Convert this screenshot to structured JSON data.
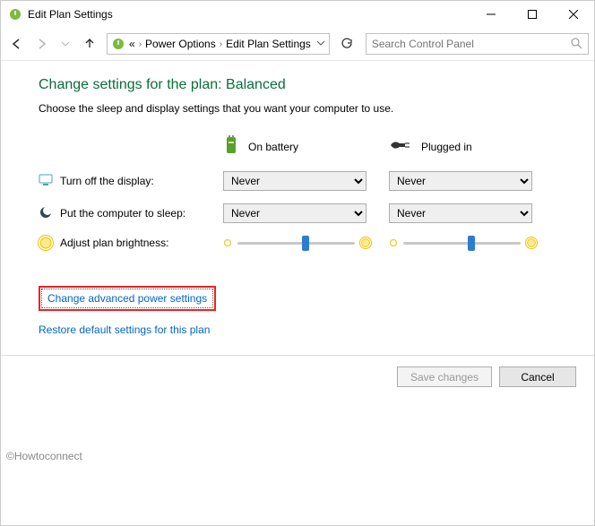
{
  "window": {
    "title": "Edit Plan Settings",
    "breadcrumb": {
      "overflow": "«",
      "item1": "Power Options",
      "item2": "Edit Plan Settings"
    },
    "search_placeholder": "Search Control Panel"
  },
  "main": {
    "heading": "Change settings for the plan: Balanced",
    "subhead": "Choose the sleep and display settings that you want your computer to use.",
    "columns": {
      "battery": "On battery",
      "plugged": "Plugged in"
    },
    "rows": {
      "display_off": {
        "label": "Turn off the display:",
        "battery_value": "Never",
        "plugged_value": "Never"
      },
      "sleep": {
        "label": "Put the computer to sleep:",
        "battery_value": "Never",
        "plugged_value": "Never"
      },
      "brightness": {
        "label": "Adjust plan brightness:",
        "battery_pos_pct": 55,
        "plugged_pos_pct": 55
      }
    },
    "links": {
      "advanced": "Change advanced power settings",
      "restore": "Restore default settings for this plan"
    }
  },
  "footer": {
    "save": "Save changes",
    "cancel": "Cancel"
  },
  "watermark": "©Howtoconnect"
}
